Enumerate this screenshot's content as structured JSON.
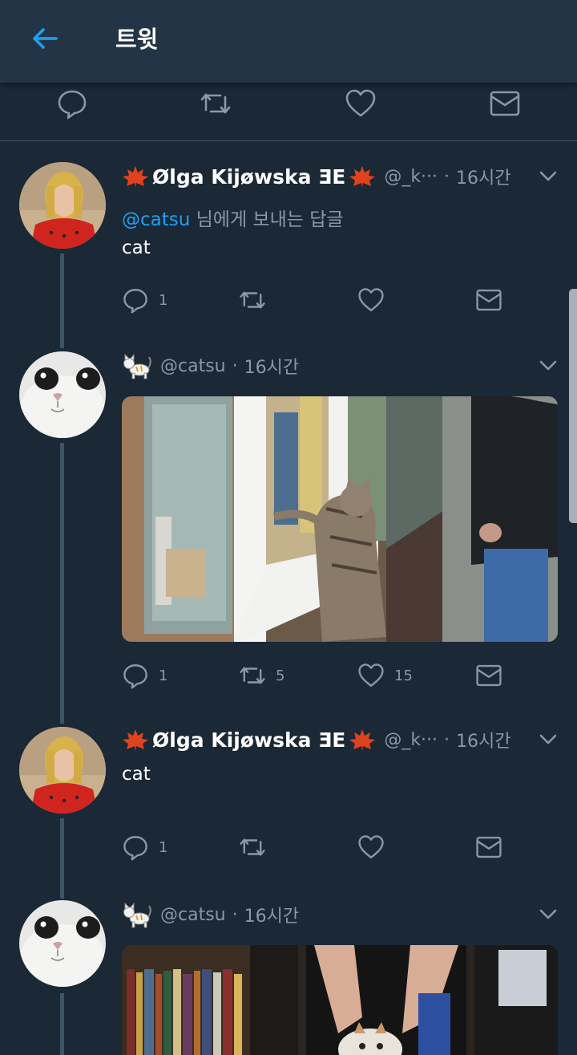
{
  "header": {
    "title": "트윗",
    "back_icon": "arrow-left-icon"
  },
  "colors": {
    "background": "#1b2836",
    "header": "#243447",
    "accent": "#1da1f2",
    "muted": "#8899a6",
    "line": "#3d5466"
  },
  "main_actions": [
    "reply-icon",
    "retweet-icon",
    "like-icon",
    "message-icon"
  ],
  "tweets": [
    {
      "name": "Ølga Kijøwska ƎE",
      "handle": "@_k···",
      "dot": "·",
      "time": "16시간",
      "replying_mention": "@catsu",
      "replying_suffix": " 님에게 보내는 답글",
      "text": "cat",
      "reply_count": "1",
      "retweet_count": "",
      "like_count": ""
    },
    {
      "name": "",
      "handle": "@catsu",
      "dot": "·",
      "time": "16시간",
      "text": "",
      "reply_count": "1",
      "retweet_count": "5",
      "like_count": "15"
    },
    {
      "name": "Ølga Kijøwska ƎE",
      "handle": "@_k···",
      "dot": "·",
      "time": "16시간",
      "text": "cat",
      "reply_count": "1",
      "retweet_count": "",
      "like_count": ""
    },
    {
      "name": "",
      "handle": "@catsu",
      "dot": "·",
      "time": "16시간"
    }
  ]
}
